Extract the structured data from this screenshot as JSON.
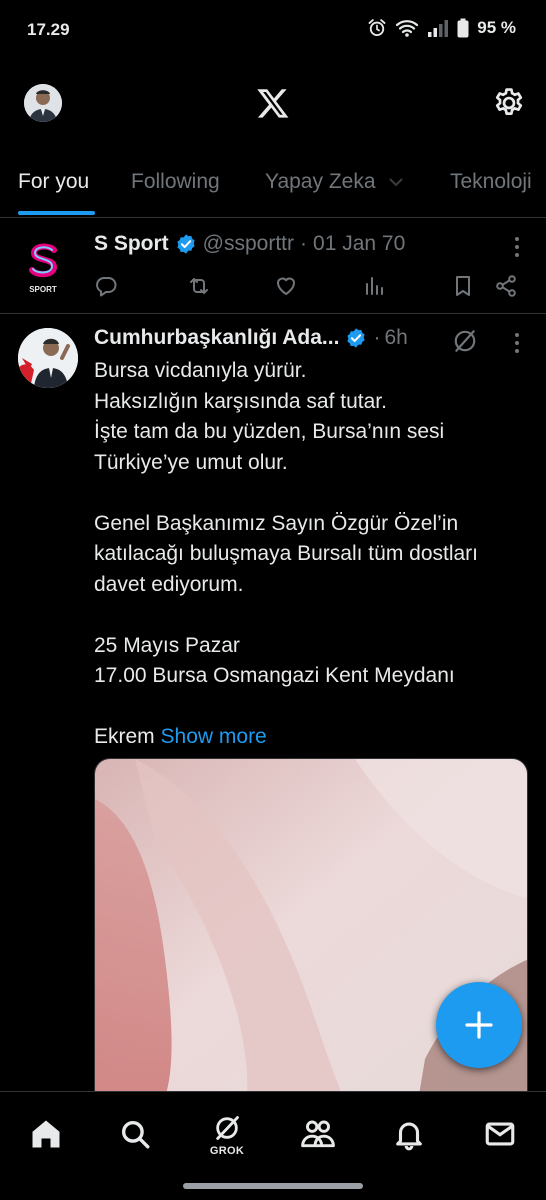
{
  "status_bar": {
    "time": "17.29",
    "battery": "95 %"
  },
  "tabs": [
    {
      "label": "For you",
      "active": true
    },
    {
      "label": "Following",
      "active": false
    },
    {
      "label": "Yapay Zeka",
      "active": false
    },
    {
      "label": "Teknoloji",
      "active": false
    }
  ],
  "posts": [
    {
      "name": "S Sport",
      "handle": "@ssporttr",
      "separator": "·",
      "time": "01 Jan 70",
      "verified": true,
      "avatar_text": "SPORT"
    },
    {
      "name": "Cumhurbaşkanlığı Ada...",
      "separator": "·",
      "time": "6h",
      "verified": true,
      "lines": [
        "Bursa vicdanıyla yürür.",
        "Haksızlığın karşısında saf tutar.",
        "İşte tam da bu yüzden, Bursa’nın sesi",
        "Türkiye’ye umut olur.",
        "",
        "Genel Başkanımız Sayın Özgür Özel’in",
        "katılacağı buluşmaya Bursalı tüm dostları",
        "davet ediyorum.",
        "",
        "25 Mayıs Pazar",
        "17.00 Bursa Osmangazi Kent Meydanı",
        ""
      ],
      "last_line_prefix": "Ekrem",
      "show_more": "Show more"
    }
  ],
  "bottom_nav": {
    "grok_label": "GROK"
  },
  "colors": {
    "accent": "#1d9bf0",
    "background": "#000000",
    "text": "#e7e9ea",
    "muted": "#71767b",
    "divider": "#2f3336"
  }
}
